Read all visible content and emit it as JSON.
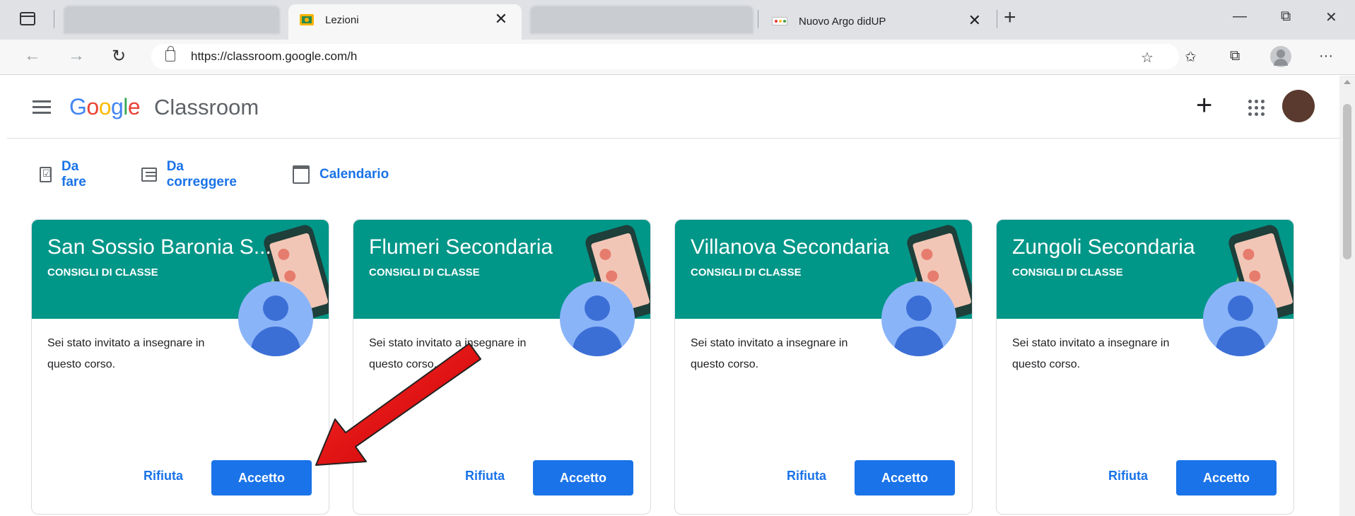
{
  "browser": {
    "tabs": [
      {
        "title": "Lezioni",
        "active": true,
        "favicon": "google-classroom-icon"
      },
      {
        "title": "Nuovo Argo didUP",
        "active": false,
        "favicon": "argo-icon"
      }
    ],
    "tab_close_glyph": "✕",
    "new_tab_glyph": "+",
    "window_controls": {
      "minimize": "—",
      "restore": "⧉",
      "close": "✕"
    },
    "url": "https://classroom.google.com/h",
    "toolbar_icons": [
      "favorites-add-icon",
      "favorites-icon",
      "collections-icon",
      "profile-icon",
      "more-icon"
    ],
    "more_glyph": "···"
  },
  "app": {
    "logo": {
      "google": "Google",
      "product": "Classroom"
    },
    "header_actions": {
      "add": "+"
    }
  },
  "subnav": [
    {
      "label": "Da fare",
      "icon": "todo-icon"
    },
    {
      "label": "Da correggere",
      "icon": "review-icon"
    },
    {
      "label": "Calendario",
      "icon": "calendar-icon"
    }
  ],
  "courses": [
    {
      "title": "San Sossio Baronia S...",
      "section": "CONSIGLI DI CLASSE",
      "message": "Sei stato invitato a insegnare in questo corso.",
      "reject": "Rifiuta",
      "accept": "Accetto"
    },
    {
      "title": "Flumeri Secondaria",
      "section": "CONSIGLI DI CLASSE",
      "message": "Sei stato invitato a insegnare in questo corso.",
      "reject": "Rifiuta",
      "accept": "Accetto"
    },
    {
      "title": "Villanova Secondaria",
      "section": "CONSIGLI DI CLASSE",
      "message": "Sei stato invitato a insegnare in questo corso.",
      "reject": "Rifiuta",
      "accept": "Accetto"
    },
    {
      "title": "Zungoli Secondaria",
      "section": "CONSIGLI DI CLASSE",
      "message": "Sei stato invitato a insegnare in questo corso.",
      "reject": "Rifiuta",
      "accept": "Accetto"
    }
  ],
  "colors": {
    "banner": "#009688",
    "accent": "#1a73e8",
    "annotation_arrow": "#e8141a"
  }
}
